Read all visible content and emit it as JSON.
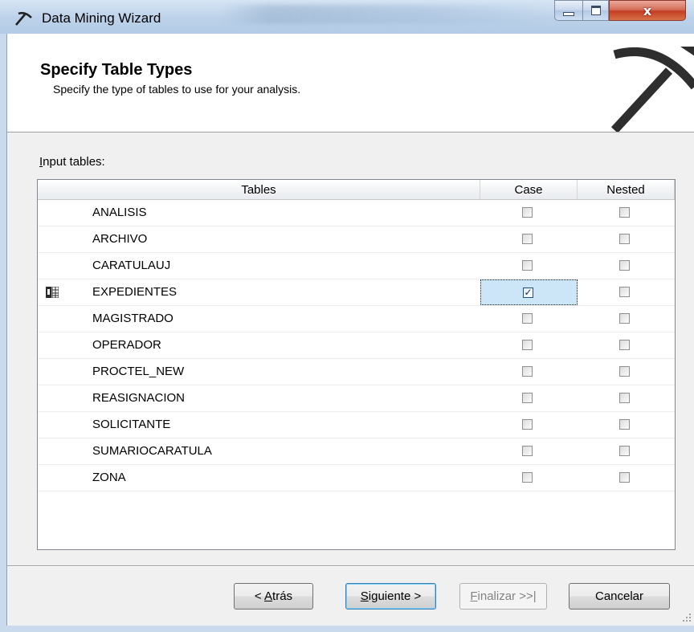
{
  "window": {
    "title": "Data Mining Wizard",
    "close_glyph": "x"
  },
  "header": {
    "title": "Specify Table Types",
    "subtitle": "Specify the type of tables to use for your analysis.",
    "logo_icon": "pickaxe-icon"
  },
  "input_tables": {
    "label": "Input tables:",
    "columns": [
      "Tables",
      "Case",
      "Nested"
    ],
    "rows": [
      {
        "name": "ANALISIS",
        "case": false,
        "nested": false
      },
      {
        "name": "ARCHIVO",
        "case": false,
        "nested": false
      },
      {
        "name": "CARATULAUJ",
        "case": false,
        "nested": false
      },
      {
        "name": "EXPEDIENTES",
        "case": true,
        "nested": false,
        "row_icon": "case-table-icon",
        "focused": "case"
      },
      {
        "name": "MAGISTRADO",
        "case": false,
        "nested": false
      },
      {
        "name": "OPERADOR",
        "case": false,
        "nested": false
      },
      {
        "name": "PROCTEL_NEW",
        "case": false,
        "nested": false
      },
      {
        "name": "REASIGNACION",
        "case": false,
        "nested": false
      },
      {
        "name": "SOLICITANTE",
        "case": false,
        "nested": false
      },
      {
        "name": "SUMARIOCARATULA",
        "case": false,
        "nested": false
      },
      {
        "name": "ZONA",
        "case": false,
        "nested": false
      }
    ]
  },
  "buttons": {
    "back": "< Atrás",
    "next": "Siguiente >",
    "finish": "Finalizar >>|",
    "cancel": "Cancelar"
  },
  "colors": {
    "focus_cell": "#cde6f7",
    "title_bar": "#bcd2ea",
    "close_button": "#c43d22"
  }
}
